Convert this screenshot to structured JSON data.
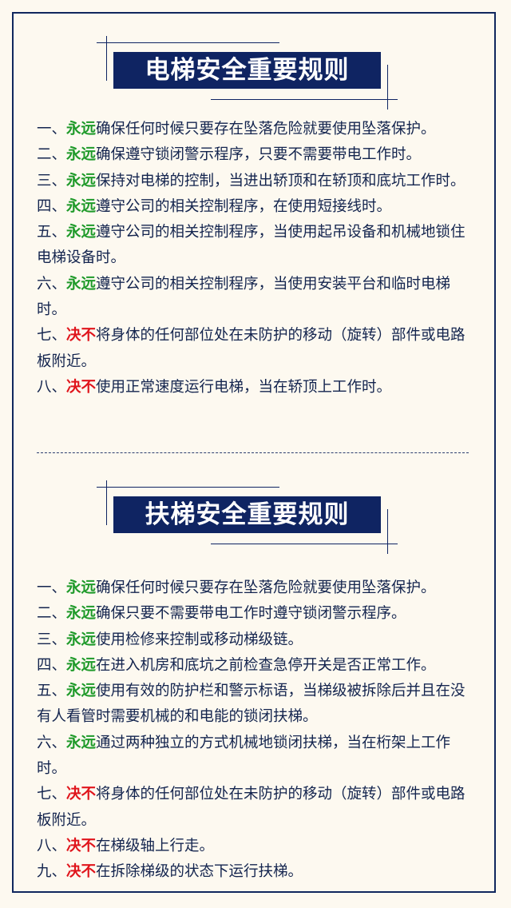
{
  "elevator": {
    "title": "电梯安全重要规则",
    "rules": [
      {
        "num": "一、",
        "keyword": "永远",
        "type": "always",
        "text": "确保任何时候只要存在坠落危险就要使用坠落保护。"
      },
      {
        "num": "二、",
        "keyword": "永远",
        "type": "always",
        "text": "确保遵守锁闭警示程序，只要不需要带电工作时。"
      },
      {
        "num": "三、",
        "keyword": "永远",
        "type": "always",
        "text": "保持对电梯的控制，当进出轿顶和在轿顶和底坑工作时。"
      },
      {
        "num": "四、",
        "keyword": "永远",
        "type": "always",
        "text": "遵守公司的相关控制程序，在使用短接线时。"
      },
      {
        "num": "五、",
        "keyword": "永远",
        "type": "always",
        "text": "遵守公司的相关控制程序，当使用起吊设备和机械地锁住电梯设备时。"
      },
      {
        "num": "六、",
        "keyword": "永远",
        "type": "always",
        "text": "遵守公司的相关控制程序，当使用安装平台和临时电梯时。"
      },
      {
        "num": "七、",
        "keyword": "决不",
        "type": "never",
        "text": "将身体的任何部位处在未防护的移动（旋转）部件或电路板附近。"
      },
      {
        "num": "八、",
        "keyword": "决不",
        "type": "never",
        "text": "使用正常速度运行电梯，当在轿顶上工作时。"
      }
    ]
  },
  "escalator": {
    "title": "扶梯安全重要规则",
    "rules": [
      {
        "num": "一、",
        "keyword": "永远",
        "type": "always",
        "text": "确保任何时候只要存在坠落危险就要使用坠落保护。"
      },
      {
        "num": "二、",
        "keyword": "永远",
        "type": "always",
        "text": "确保只要不需要带电工作时遵守锁闭警示程序。"
      },
      {
        "num": "三、",
        "keyword": "永远",
        "type": "always",
        "text": "使用检修来控制或移动梯级链。"
      },
      {
        "num": "四、",
        "keyword": "永远",
        "type": "always",
        "text": "在进入机房和底坑之前检查急停开关是否正常工作。"
      },
      {
        "num": "五、",
        "keyword": "永远",
        "type": "always",
        "text": "使用有效的防护栏和警示标语，当梯级被拆除后并且在没有人看管时需要机械的和电能的锁闭扶梯。"
      },
      {
        "num": "六、",
        "keyword": "永远",
        "type": "always",
        "text": "通过两种独立的方式机械地锁闭扶梯，当在桁架上工作时。"
      },
      {
        "num": "七、",
        "keyword": "决不",
        "type": "never",
        "text": "将身体的任何部位处在未防护的移动（旋转）部件或电路板附近。"
      },
      {
        "num": "八、",
        "keyword": "决不",
        "type": "never",
        "text": "在梯级轴上行走。"
      },
      {
        "num": "九、",
        "keyword": "决不",
        "type": "never",
        "text": "在拆除梯级的状态下运行扶梯。"
      }
    ]
  },
  "colors": {
    "navy": "#0f2462",
    "always": "#1f9a2a",
    "never": "#e0151c",
    "text": "#13244e",
    "background": "#fdf9f0"
  }
}
